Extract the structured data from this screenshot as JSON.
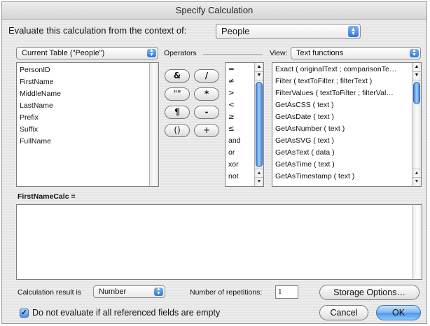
{
  "dialog": {
    "title": "Specify Calculation",
    "context_label": "Evaluate this calculation from the context of:",
    "context_value": "People"
  },
  "fields": {
    "table_popup": "Current Table (\"People\")",
    "items": [
      "PersonID",
      "FirstName",
      "MiddleName",
      "LastName",
      "Prefix",
      "Suffix",
      "FullName"
    ]
  },
  "operators": {
    "label": "Operators",
    "buttons": [
      "&",
      "/",
      "\"\"",
      "*",
      "¶",
      "-",
      "()",
      "+"
    ],
    "list": [
      "=",
      "≠",
      ">",
      "<",
      "≥",
      "≤",
      "and",
      "or",
      "xor",
      "not"
    ]
  },
  "functions": {
    "view_label": "View:",
    "view_value": "Text functions",
    "items": [
      "Exact ( originalText ; comparisonTe…",
      "Filter ( textToFilter ; filterText )",
      "FilterValues ( textToFilter ; filterVal…",
      "GetAsCSS ( text )",
      "GetAsDate ( text )",
      "GetAsNumber ( text )",
      "GetAsSVG ( text )",
      "GetAsText ( data )",
      "GetAsTime ( text )",
      "GetAsTimestamp ( text )"
    ]
  },
  "formula": {
    "label": "FirstNameCalc =",
    "text": ""
  },
  "bottom": {
    "result_label": "Calculation result is",
    "result_value": "Number",
    "repetitions_label": "Number of repetitions:",
    "repetitions_value": "1",
    "storage_button": "Storage Options…",
    "checkbox_label": "Do not evaluate if all referenced fields are empty",
    "checkbox_checked": true,
    "cancel_button": "Cancel",
    "ok_button": "OK"
  }
}
